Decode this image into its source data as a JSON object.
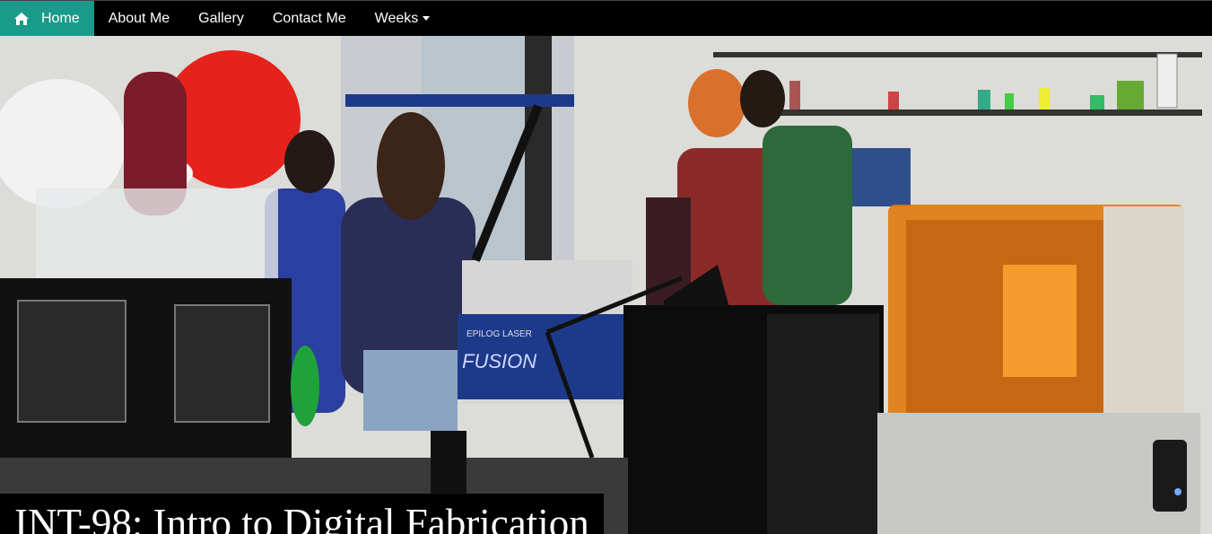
{
  "nav": {
    "items": [
      {
        "label": "Home",
        "icon": "home-icon",
        "active": true
      },
      {
        "label": "About Me"
      },
      {
        "label": "Gallery"
      },
      {
        "label": "Contact Me"
      },
      {
        "label": "Weeks",
        "icon": "caret-down-icon"
      }
    ]
  },
  "hero": {
    "title": "INT-98: Intro to Digital Fabrication",
    "printer_brand": "EPILOG LASER",
    "printer_model": "FUSION"
  },
  "colors": {
    "accent": "#1a9a8a",
    "navbar": "#000000",
    "printer_orange": "#e07a10"
  }
}
